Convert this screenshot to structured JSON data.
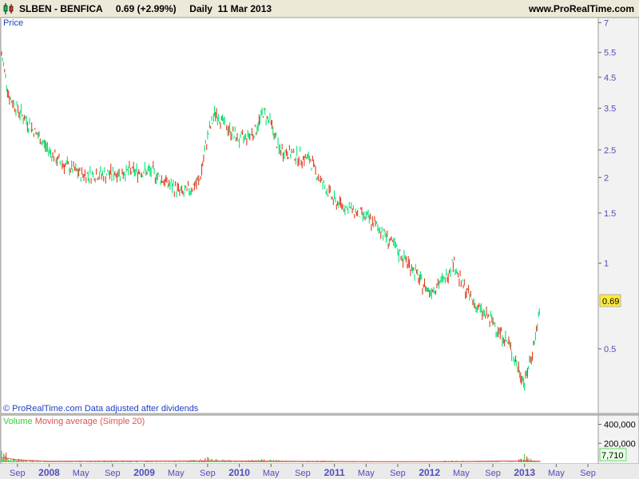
{
  "header": {
    "symbol": "SLBEN - BENFICA",
    "last": "0.69 (+2.99%)",
    "period": "Daily  11 Mar 2013",
    "site": "www.ProRealTime.com"
  },
  "price_panel": {
    "label": "Price",
    "footer": "© ProRealTime.com  Data adjusted after dividends",
    "last_badge": "0.69"
  },
  "volume_panel": {
    "label_volume": "Volume",
    "label_ma": "Moving average (Simple 20)",
    "last_badge": "7,710"
  },
  "colors": {
    "up": "#00e676",
    "down": "#e23b1e",
    "volume": "#32cd32",
    "ma": "#e05050",
    "axis_text": "#4f4fb8",
    "panel_label": "#1f3fbf",
    "badge_price": "#ffeb3b",
    "badge_volume": "#e6ffe6"
  },
  "chart_data": [
    {
      "type": "line",
      "title": "SLBEN - BENFICA",
      "ylabel": "Price",
      "yscale": "log",
      "ylim": [
        0.3,
        7.2
      ],
      "yticks": [
        7,
        5.5,
        4.5,
        3.5,
        2.5,
        2,
        1.5,
        1,
        0.5
      ],
      "xlim": [
        "2007-07",
        "2013-10"
      ],
      "xticks": [
        {
          "label": "Sep",
          "date": "2007-09"
        },
        {
          "label": "2008",
          "date": "2008-01"
        },
        {
          "label": "May",
          "date": "2008-05"
        },
        {
          "label": "Sep",
          "date": "2008-09"
        },
        {
          "label": "2009",
          "date": "2009-01"
        },
        {
          "label": "May",
          "date": "2009-05"
        },
        {
          "label": "Sep",
          "date": "2009-09"
        },
        {
          "label": "2010",
          "date": "2010-01"
        },
        {
          "label": "May",
          "date": "2010-05"
        },
        {
          "label": "Sep",
          "date": "2010-09"
        },
        {
          "label": "2011",
          "date": "2011-01"
        },
        {
          "label": "May",
          "date": "2011-05"
        },
        {
          "label": "Sep",
          "date": "2011-09"
        },
        {
          "label": "2012",
          "date": "2012-01"
        },
        {
          "label": "May",
          "date": "2012-05"
        },
        {
          "label": "Sep",
          "date": "2012-09"
        },
        {
          "label": "2013",
          "date": "2013-01"
        },
        {
          "label": "May",
          "date": "2013-05"
        },
        {
          "label": "Sep",
          "date": "2013-09"
        }
      ],
      "series": [
        {
          "points": [
            {
              "date": "2007-07",
              "close": 5.4
            },
            {
              "date": "2007-08",
              "close": 3.8
            },
            {
              "date": "2007-10",
              "close": 3.2
            },
            {
              "date": "2007-12",
              "close": 2.7
            },
            {
              "date": "2008-02",
              "close": 2.3
            },
            {
              "date": "2008-05",
              "close": 2.05
            },
            {
              "date": "2008-08",
              "close": 2.05
            },
            {
              "date": "2008-11",
              "close": 2.1
            },
            {
              "date": "2009-02",
              "close": 2.1
            },
            {
              "date": "2009-04",
              "close": 1.9
            },
            {
              "date": "2009-06",
              "close": 1.75
            },
            {
              "date": "2009-08",
              "close": 1.95
            },
            {
              "date": "2009-09",
              "close": 2.8
            },
            {
              "date": "2009-10",
              "close": 3.4
            },
            {
              "date": "2009-11",
              "close": 3.1
            },
            {
              "date": "2010-01",
              "close": 2.7
            },
            {
              "date": "2010-03",
              "close": 2.9
            },
            {
              "date": "2010-04",
              "close": 3.4
            },
            {
              "date": "2010-05",
              "close": 3.1
            },
            {
              "date": "2010-06",
              "close": 2.5
            },
            {
              "date": "2010-08",
              "close": 2.4
            },
            {
              "date": "2010-10",
              "close": 2.3
            },
            {
              "date": "2010-11",
              "close": 2.0
            },
            {
              "date": "2011-01",
              "close": 1.65
            },
            {
              "date": "2011-03",
              "close": 1.55
            },
            {
              "date": "2011-05",
              "close": 1.45
            },
            {
              "date": "2011-07",
              "close": 1.3
            },
            {
              "date": "2011-09",
              "close": 1.1
            },
            {
              "date": "2011-11",
              "close": 0.95
            },
            {
              "date": "2011-12",
              "close": 0.85
            },
            {
              "date": "2012-01",
              "close": 0.8
            },
            {
              "date": "2012-03",
              "close": 0.88
            },
            {
              "date": "2012-04",
              "close": 1.02
            },
            {
              "date": "2012-05",
              "close": 0.85
            },
            {
              "date": "2012-07",
              "close": 0.7
            },
            {
              "date": "2012-09",
              "close": 0.62
            },
            {
              "date": "2012-11",
              "close": 0.52
            },
            {
              "date": "2012-12",
              "close": 0.44
            },
            {
              "date": "2013-01",
              "close": 0.38
            },
            {
              "date": "2013-02",
              "close": 0.49
            },
            {
              "date": "2013-03",
              "close": 0.69
            }
          ]
        }
      ]
    },
    {
      "type": "bar",
      "title": "Volume",
      "ylim": [
        0,
        480000
      ],
      "yticks": [
        400000,
        200000
      ],
      "series": [
        {
          "name": "Volume",
          "points": [
            {
              "date": "2007-07",
              "value": 150000
            },
            {
              "date": "2007-08",
              "value": 60000
            },
            {
              "date": "2007-09",
              "value": 30000
            },
            {
              "date": "2007-11",
              "value": 15000
            },
            {
              "date": "2008-02",
              "value": 10000
            },
            {
              "date": "2008-05",
              "value": 8000
            },
            {
              "date": "2008-09",
              "value": 20000
            },
            {
              "date": "2008-12",
              "value": 10000
            },
            {
              "date": "2009-03",
              "value": 8000
            },
            {
              "date": "2009-06",
              "value": 10000
            },
            {
              "date": "2009-09",
              "value": 45000
            },
            {
              "date": "2009-10",
              "value": 30000
            },
            {
              "date": "2010-01",
              "value": 12000
            },
            {
              "date": "2010-04",
              "value": 28000
            },
            {
              "date": "2010-05",
              "value": 25000
            },
            {
              "date": "2010-08",
              "value": 10000
            },
            {
              "date": "2010-11",
              "value": 15000
            },
            {
              "date": "2011-02",
              "value": 12000
            },
            {
              "date": "2011-06",
              "value": 10000
            },
            {
              "date": "2011-10",
              "value": 8000
            },
            {
              "date": "2012-01",
              "value": 8000
            },
            {
              "date": "2012-04",
              "value": 15000
            },
            {
              "date": "2012-08",
              "value": 10000
            },
            {
              "date": "2012-12",
              "value": 8000
            },
            {
              "date": "2013-01",
              "value": 70000
            },
            {
              "date": "2013-02",
              "value": 20000
            },
            {
              "date": "2013-03",
              "value": 7710
            }
          ]
        },
        {
          "name": "Moving average (Simple 20)",
          "points": [
            {
              "date": "2007-07",
              "value": 50000
            },
            {
              "date": "2007-09",
              "value": 25000
            },
            {
              "date": "2008-01",
              "value": 10000
            },
            {
              "date": "2009-09",
              "value": 15000
            },
            {
              "date": "2010-04",
              "value": 12000
            },
            {
              "date": "2011-06",
              "value": 6000
            },
            {
              "date": "2012-04",
              "value": 7000
            },
            {
              "date": "2013-01",
              "value": 15000
            },
            {
              "date": "2013-03",
              "value": 10000
            }
          ]
        }
      ]
    }
  ]
}
